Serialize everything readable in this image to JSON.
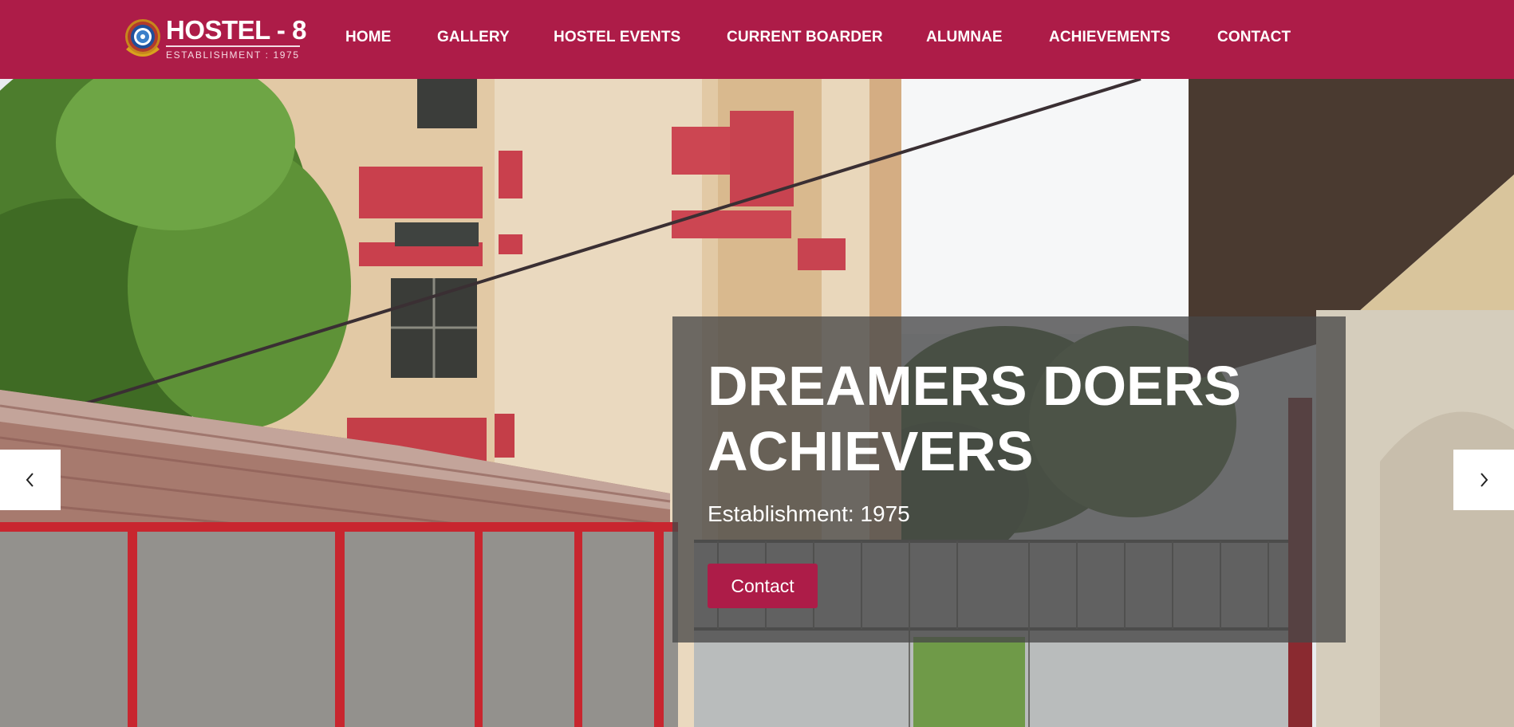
{
  "brand": {
    "title": "HOSTEL - 8",
    "subtitle": "ESTABLISHMENT : 1975",
    "logo_icon": "emblem-icon"
  },
  "nav": {
    "items": [
      {
        "label": "HOME"
      },
      {
        "label": "GALLERY"
      },
      {
        "label": "HOSTEL EVENTS"
      },
      {
        "label": "CURRENT BOARDER"
      },
      {
        "label": "ALUMNAE"
      },
      {
        "label": "ACHIEVEMENTS"
      },
      {
        "label": "CONTACT"
      }
    ]
  },
  "hero": {
    "title": "DREAMERS DOERS ACHIEVERS",
    "subtitle": "Establishment: 1975",
    "button_label": "Contact",
    "prev_icon": "chevron-left-icon",
    "next_icon": "chevron-right-icon"
  },
  "colors": {
    "primary": "#ad1c48",
    "caption_bg": "#484848"
  }
}
